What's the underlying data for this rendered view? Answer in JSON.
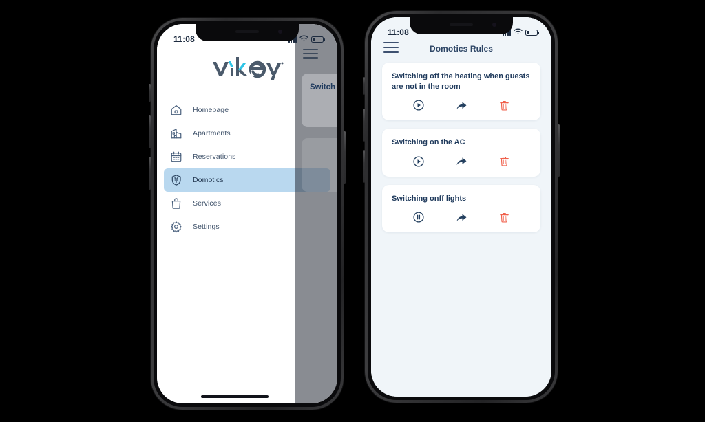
{
  "colors": {
    "app_bg": "#f0f5f9",
    "drawer_bg": "#ffffff",
    "accent_navy": "#1f3a5c",
    "nav_text": "#40536b",
    "nav_active_bg": "#b9d8ef",
    "logo_dark": "#4b5a6b",
    "logo_cyan": "#2ec4e6",
    "danger_red": "#f0614c",
    "card_bg": "#ffffff"
  },
  "left_phone": {
    "status_bar": {
      "time": "11:08",
      "signal_icon": "cellular-signal-icon",
      "wifi_icon": "wifi-icon",
      "battery_icon": "battery-icon"
    },
    "drawer": {
      "logo_text": "vikey",
      "logo_trademark": "®",
      "items": [
        {
          "label": "Homepage",
          "icon": "home-icon",
          "active": false
        },
        {
          "label": "Apartments",
          "icon": "building-icon",
          "active": false
        },
        {
          "label": "Reservations",
          "icon": "calendar-icon",
          "active": false
        },
        {
          "label": "Domotics",
          "icon": "plug-shield-icon",
          "active": true
        },
        {
          "label": "Services",
          "icon": "bag-icon",
          "active": false
        },
        {
          "label": "Settings",
          "icon": "gear-icon",
          "active": false
        }
      ]
    },
    "dimmed_background": {
      "menu_icon": "hamburger-menu-icon",
      "partial_card_title": "Switch"
    },
    "home_indicator": "home-indicator"
  },
  "right_phone": {
    "status_bar": {
      "time": "11:08",
      "signal_icon": "cellular-signal-icon",
      "wifi_icon": "wifi-icon",
      "battery_icon": "battery-icon"
    },
    "appbar": {
      "menu_icon": "hamburger-menu-icon",
      "title": "Domotics Rules"
    },
    "rules": [
      {
        "title": "Switching off the heating when guests are not in the room",
        "play_state": "play",
        "actions": [
          "play-icon",
          "share-icon",
          "delete-icon"
        ]
      },
      {
        "title": "Switching on the AC",
        "play_state": "play",
        "actions": [
          "play-icon",
          "share-icon",
          "delete-icon"
        ]
      },
      {
        "title": "Switching onff lights",
        "play_state": "pause",
        "actions": [
          "pause-icon",
          "share-icon",
          "delete-icon"
        ]
      }
    ]
  }
}
